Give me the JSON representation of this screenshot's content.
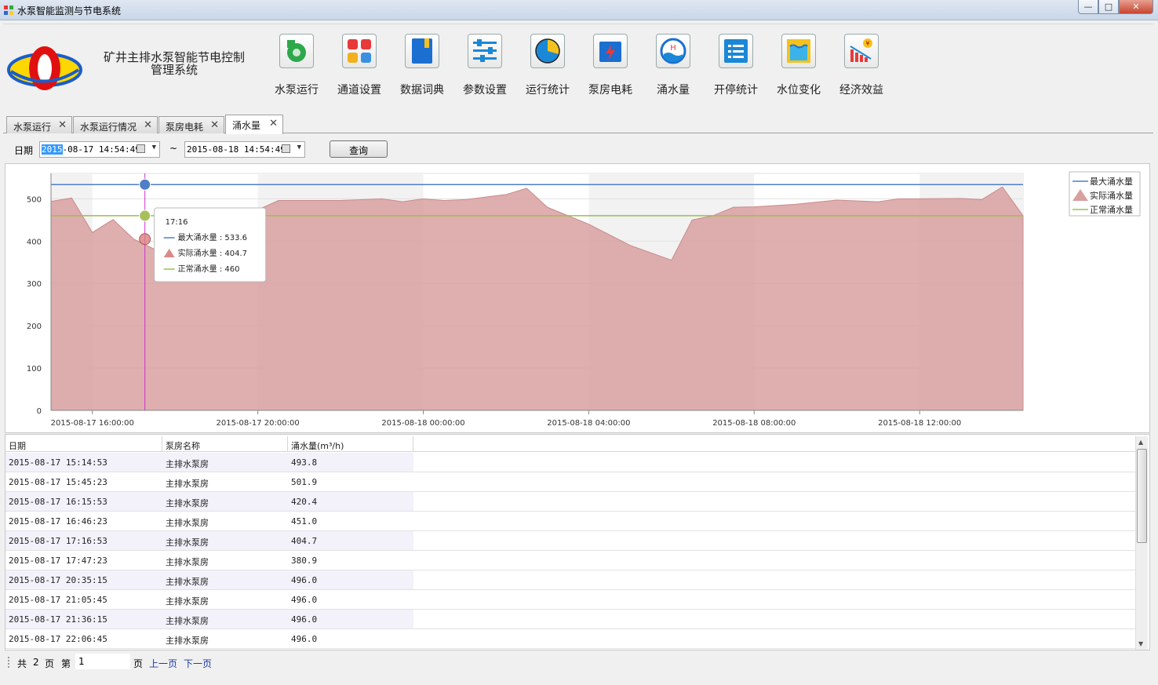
{
  "window": {
    "title": "水泵智能监测与节电系统",
    "buttons": {
      "minimize": "—",
      "maximize": "□",
      "close": "✕"
    }
  },
  "header": {
    "system_title": "矿井主排水泵智能节电控制管理系统",
    "toolbar": [
      {
        "label": "水泵运行",
        "icon": "pump-icon"
      },
      {
        "label": "通道设置",
        "icon": "channel-grid-icon"
      },
      {
        "label": "数据词典",
        "icon": "book-icon"
      },
      {
        "label": "参数设置",
        "icon": "sliders-icon"
      },
      {
        "label": "运行统计",
        "icon": "pie-icon"
      },
      {
        "label": "泵房电耗",
        "icon": "power-icon"
      },
      {
        "label": "涌水量",
        "icon": "water-meter-icon"
      },
      {
        "label": "开停统计",
        "icon": "list-icon"
      },
      {
        "label": "水位变化",
        "icon": "water-level-icon"
      },
      {
        "label": "经济效益",
        "icon": "profit-chart-icon"
      }
    ]
  },
  "tabs": [
    {
      "label": "水泵运行",
      "active": false
    },
    {
      "label": "水泵运行情况",
      "active": false
    },
    {
      "label": "泵房电耗",
      "active": false
    },
    {
      "label": "涌水量",
      "active": true
    }
  ],
  "query": {
    "date_label": "日期",
    "start_sel": "2015",
    "start_rest": "-08-17 14:54:49",
    "separator": "~",
    "end": "2015-08-18 14:54:49",
    "button": "查询"
  },
  "chart_data": {
    "type": "area",
    "x_ticks": [
      "2015-08-17 16:00:00",
      "2015-08-17 20:00:00",
      "2015-08-18 00:00:00",
      "2015-08-18 04:00:00",
      "2015-08-18 08:00:00",
      "2015-08-18 12:00:00"
    ],
    "x_range_hours": [
      15.0,
      38.5
    ],
    "ylim": [
      0,
      560
    ],
    "y_ticks": [
      0,
      100,
      200,
      300,
      400,
      500
    ],
    "legend_position": "top-right",
    "series": [
      {
        "name": "最大涌水量",
        "kind": "line",
        "color": "#4f7fc6",
        "value": 533.6
      },
      {
        "name": "实际涌水量",
        "kind": "area",
        "color": "#d9a0a0",
        "x": [
          15.0,
          15.5,
          16.0,
          16.5,
          17.0,
          17.5,
          18.0,
          19.0,
          20.5,
          21.0,
          21.5,
          22.0,
          23.0,
          23.5,
          24.0,
          24.5,
          25.0,
          26.0,
          26.5,
          27.0,
          28.0,
          29.0,
          30.0,
          30.5,
          31.0,
          31.5,
          32.0,
          33.0,
          34.0,
          35.0,
          35.5,
          36.0,
          37.0,
          37.5,
          38.0,
          38.5
        ],
        "y": [
          493.8,
          501.9,
          420.4,
          451.0,
          404.7,
          380.9,
          380.0,
          430.0,
          496.0,
          496.0,
          496.0,
          496.0,
          500.0,
          493.0,
          500.0,
          496.0,
          498.0,
          510.0,
          525.0,
          480.0,
          440.0,
          390.0,
          355.0,
          450.0,
          460.0,
          480.0,
          481.0,
          487.0,
          497.0,
          493.0,
          500.0,
          500.0,
          501.0,
          498.0,
          528.0,
          460.0
        ]
      },
      {
        "name": "正常涌水量",
        "kind": "line",
        "color": "#9cc04a",
        "value": 460
      }
    ],
    "tooltip": {
      "time": "17:16",
      "rows": [
        {
          "label": "最大涌水量 : 533.6"
        },
        {
          "label": "实际涌水量 : 404.7"
        },
        {
          "label": "正常涌水量 : 460"
        }
      ]
    }
  },
  "table": {
    "columns": [
      "日期",
      "泵房名称",
      "涌水量(m³/h)"
    ],
    "rows": [
      [
        "2015-08-17 15:14:53",
        "主排水泵房",
        "493.8"
      ],
      [
        "2015-08-17 15:45:23",
        "主排水泵房",
        "501.9"
      ],
      [
        "2015-08-17 16:15:53",
        "主排水泵房",
        "420.4"
      ],
      [
        "2015-08-17 16:46:23",
        "主排水泵房",
        "451.0"
      ],
      [
        "2015-08-17 17:16:53",
        "主排水泵房",
        "404.7"
      ],
      [
        "2015-08-17 17:47:23",
        "主排水泵房",
        "380.9"
      ],
      [
        "2015-08-17 20:35:15",
        "主排水泵房",
        "496.0"
      ],
      [
        "2015-08-17 21:05:45",
        "主排水泵房",
        "496.0"
      ],
      [
        "2015-08-17 21:36:15",
        "主排水泵房",
        "496.0"
      ],
      [
        "2015-08-17 22:06:45",
        "主排水泵房",
        "496.0"
      ]
    ]
  },
  "pager": {
    "total_prefix": "共",
    "total_pages": "2",
    "page_word1": "页",
    "current_prefix": "第",
    "current_page": "1",
    "page_word2": "页",
    "prev": "上一页",
    "next": "下一页"
  }
}
